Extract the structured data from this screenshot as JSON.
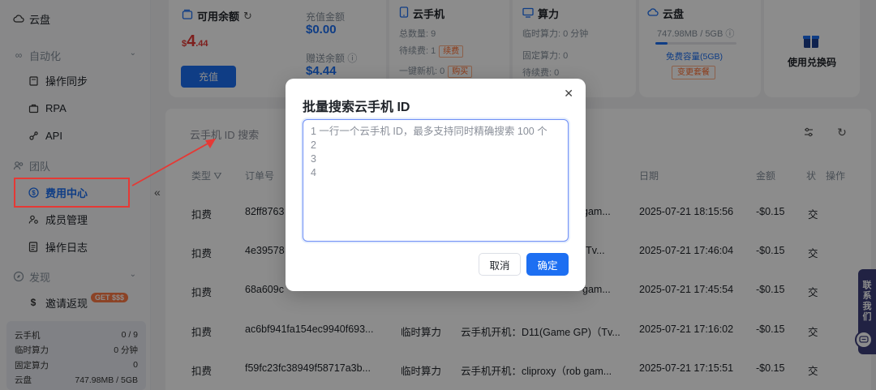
{
  "sidebar": {
    "top_item": "云盘",
    "group_automation": "自动化",
    "automation_items": [
      "操作同步",
      "RPA",
      "API"
    ],
    "group_team": "团队",
    "team_items": [
      "费用中心",
      "成员管理",
      "操作日志"
    ],
    "group_discover": "发现",
    "discover_item": "邀请返现",
    "discover_badge": "GET $$$",
    "collapse_glyph": "«",
    "stats": [
      {
        "label": "云手机",
        "value": "0 / 9"
      },
      {
        "label": "临时算力",
        "value": "0 分钟"
      },
      {
        "label": "固定算力",
        "value": "0"
      },
      {
        "label": "云盘",
        "value": "747.98MB / 5GB"
      }
    ]
  },
  "balance": {
    "title": "可用余额",
    "amount_symbol": "$",
    "amount_int": "4",
    "amount_dec": ".44",
    "recharge_label": "充值金额",
    "recharge_value": "$0.00",
    "gift_label": "赠送余额",
    "gift_value": "$4.44",
    "recharge_button": "充值"
  },
  "phone_card": {
    "title": "云手机",
    "total": "总数量: 9",
    "pending": "待续费: 1",
    "pending_tag": "续费",
    "new_phone": "一键新机: 0",
    "buy_tag": "购买"
  },
  "compute_card": {
    "title": "算力",
    "temp": "临时算力: 0 分钟",
    "fixed": "固定算力: 0",
    "pending": "待续费: 0"
  },
  "disk_card": {
    "title": "云盘",
    "usage": "747.98MB / 5GB",
    "usage_fraction": 0.146,
    "free_capacity": "免费容量(5GB)",
    "upgrade_button": "变更套餐"
  },
  "redeem": {
    "label": "使用兑换码"
  },
  "list": {
    "search_placeholder": "云手机 ID 搜索",
    "headers": [
      "类型",
      "订单号",
      "日期",
      "金额",
      "状",
      "操作"
    ],
    "rows": [
      {
        "type": "扣费",
        "order": "82ff8763",
        "category": "",
        "desc": "gam...",
        "date": "2025-07-21 18:15:56",
        "amount": "-$0.15",
        "status": "交"
      },
      {
        "type": "扣费",
        "order": "4e39578",
        "category": "",
        "desc": "(Tv...",
        "date": "2025-07-21 17:46:04",
        "amount": "-$0.15",
        "status": "交"
      },
      {
        "type": "扣费",
        "order": "68a609c",
        "category": "",
        "desc": "gam...",
        "date": "2025-07-21 17:45:54",
        "amount": "-$0.15",
        "status": "交"
      },
      {
        "type": "扣费",
        "order": "ac6bf941fa154ec9940f693...",
        "category": "临时算力",
        "desc": "云手机开机：D11(Game GP)（Tv...",
        "date": "2025-07-21 17:16:02",
        "amount": "-$0.15",
        "status": "交"
      },
      {
        "type": "扣费",
        "order": "f59fc23fc38949f58717a3b...",
        "category": "临时算力",
        "desc": "云手机开机：cliproxy（rob gam...",
        "date": "2025-07-21 17:15:51",
        "amount": "-$0.15",
        "status": "交"
      }
    ]
  },
  "modal": {
    "title": "批量搜索云手机 ID",
    "placeholder": "1 一行一个云手机 ID，最多支持同时精确搜索 100 个\n2\n3\n4",
    "cancel": "取消",
    "confirm": "确定",
    "close_glyph": "✕"
  },
  "contact": {
    "chars": [
      "联",
      "系",
      "我",
      "们"
    ]
  },
  "colors": {
    "primary": "#1d6ff2",
    "annotation_red": "#e53935",
    "contact_bg": "#3c3f7a"
  }
}
